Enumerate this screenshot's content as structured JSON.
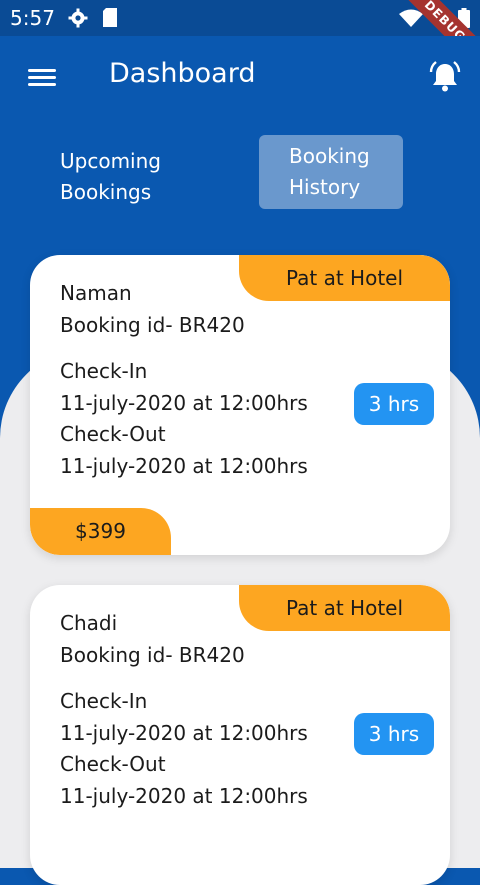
{
  "status_bar": {
    "time": "5:57",
    "debug_label": "DEBUG"
  },
  "app_bar": {
    "title": "Dashboard"
  },
  "tabs": [
    {
      "label": "Upcoming\nBookings",
      "selected": false
    },
    {
      "label": "Booking\nHistory",
      "selected": true
    }
  ],
  "bookings": [
    {
      "status": "Pat at Hotel",
      "name": "Naman",
      "booking_id": "Booking id- BR420",
      "checkin_label": "Check-In",
      "checkin": "11-july-2020 at 12:00hrs",
      "checkout_label": "Check-Out",
      "checkout": "11-july-2020 at 12:00hrs",
      "duration": "3 hrs",
      "price": "$399"
    },
    {
      "status": "Pat at Hotel",
      "name": "Chadi",
      "booking_id": "Booking id- BR420",
      "checkin_label": "Check-In",
      "checkin": "11-july-2020 at 12:00hrs",
      "checkout_label": "Check-Out",
      "checkout": "11-july-2020 at 12:00hrs",
      "duration": "3 hrs"
    }
  ],
  "colors": {
    "primary": "#0a58b0",
    "accent_orange": "#fda621",
    "accent_blue": "#2394f2",
    "background": "#ededef"
  }
}
